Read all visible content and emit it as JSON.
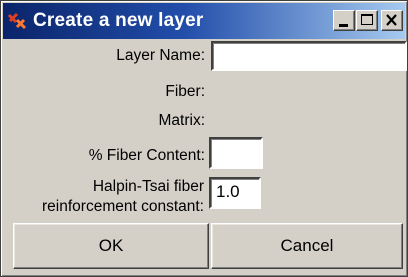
{
  "window": {
    "title": "Create a new layer",
    "controls": [
      "minimize-icon",
      "maximize-icon",
      "close-icon"
    ]
  },
  "form": {
    "layer_name_label": "Layer Name:",
    "layer_name_value": "",
    "fiber_label": "Fiber:",
    "matrix_label": "Matrix:",
    "fiber_content_label": "% Fiber Content:",
    "fiber_content_value": "",
    "halpin_label_line1": "Halpin-Tsai fiber",
    "halpin_label_line2": "reinforcement constant:",
    "halpin_value": "1.0"
  },
  "buttons": {
    "ok_label": "OK",
    "cancel_label": "Cancel"
  },
  "colors": {
    "titlebar_start": "#0a246a",
    "titlebar_end": "#a6caf0",
    "face": "#d4d0c8"
  }
}
